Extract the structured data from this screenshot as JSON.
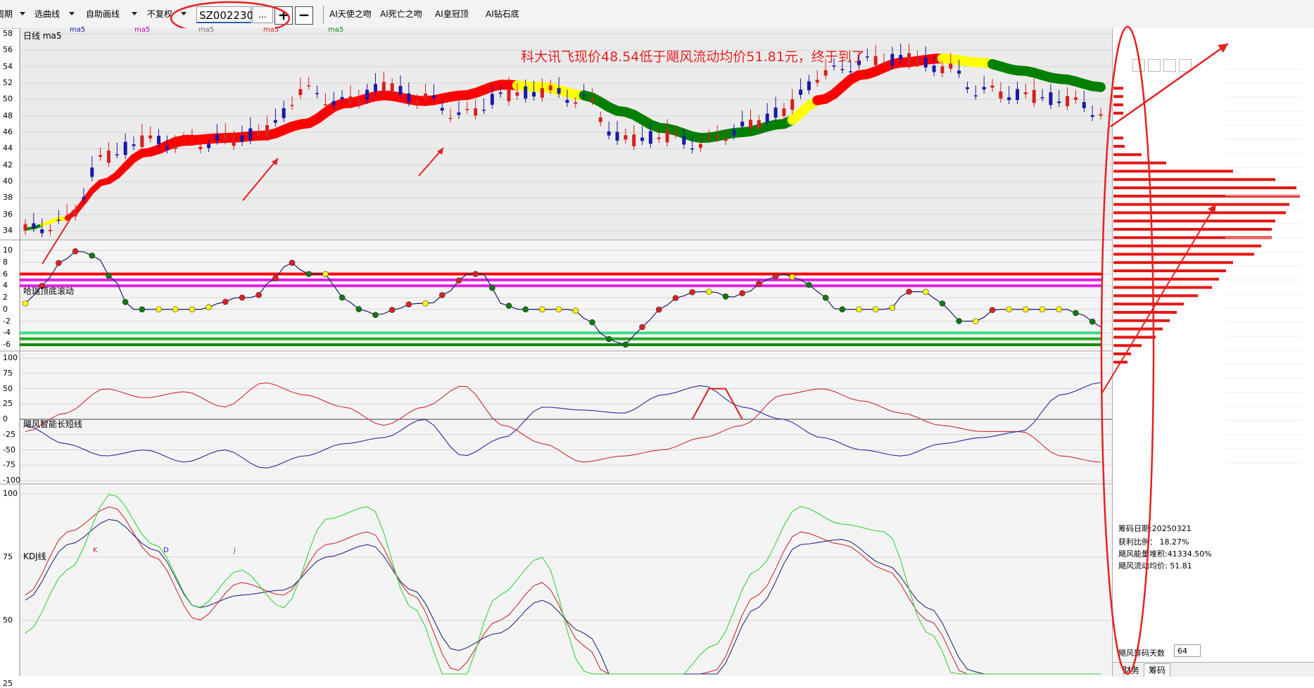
{
  "toolbar": {
    "period": "周期",
    "select_line": "选曲线",
    "draw_line": "自助画线",
    "adjust": "不复权",
    "stock_code": "SZ002230",
    "dots": "...",
    "plus": "+",
    "minus": "−",
    "ai_angel_kiss": "AI天使之吻",
    "ai_death_kiss": "AI死亡之吻",
    "ai_crown_top": "AI皇冠顶",
    "ai_diamond_bottom": "AI钻石底"
  },
  "main_panel": {
    "label": "日线 ma5",
    "ma_labels": [
      "ma5",
      "ma5",
      "ma5",
      "ma5",
      "ma5"
    ],
    "y_ticks": [
      "58",
      "56",
      "54",
      "52",
      "50",
      "48",
      "46",
      "44",
      "42",
      "40",
      "38",
      "36",
      "34"
    ],
    "annotation": "科大讯飞现价48.54低于飓风流动均价51.81元，终于到了"
  },
  "osc_panel": {
    "label": "哈瑞顶底滚动",
    "y_ticks": [
      "10",
      "8",
      "6",
      "4",
      "2",
      "0",
      "-2",
      "-4",
      "-6"
    ]
  },
  "hurricane_panel": {
    "label": "飓风智能长短线",
    "y_ticks": [
      "100",
      "75",
      "50",
      "25",
      "0",
      "-25",
      "-50",
      "-75",
      "-100"
    ]
  },
  "kdj_panel": {
    "label": "KDJ线",
    "k": "K",
    "d": "D",
    "j": "J",
    "y_ticks": [
      "100",
      "75",
      "50",
      "25"
    ]
  },
  "side_panel": {
    "chip_date": "筹码日期:20250321",
    "profit_ratio": "获利比例：  18.27%",
    "energy_stack": "飓风能量堆积:41334.50%",
    "flow_avg": "飓风流动均价: 51.81",
    "days_label": "飓风筹码天数",
    "days_value": "64",
    "tab_finance": "财务",
    "tab_chips": "筹码"
  },
  "colors": {
    "up": "#d62020",
    "down": "#1a1aa8",
    "ribbon_red": "#ff0000",
    "ribbon_yellow": "#ffff00",
    "ribbon_green": "#008000",
    "annotation": "#e32222"
  },
  "chart_data": {
    "type": "line",
    "title": "日线",
    "price_ylim": [
      34,
      58
    ],
    "osc_ylim": [
      -6,
      10
    ],
    "hurricane_ylim": [
      -100,
      100
    ],
    "kdj_ylim": [
      0,
      100
    ],
    "current_price": 48.54,
    "flow_avg_price": 51.81,
    "osc_levels": [
      6,
      5,
      4,
      -4,
      -5,
      -6
    ]
  }
}
